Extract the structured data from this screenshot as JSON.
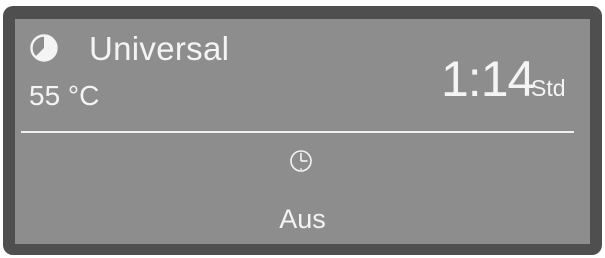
{
  "display": {
    "program": {
      "icon": "program-progress-icon",
      "name": "Universal"
    },
    "temperature": "55 °C",
    "remaining_time": {
      "value": "1:14",
      "unit": "Std"
    },
    "start_delay": {
      "icon": "clock-icon",
      "status": "Aus"
    }
  },
  "colors": {
    "bezel": "#4f4f4f",
    "screen": "#8d8d8d",
    "text": "#f4f4f4"
  }
}
